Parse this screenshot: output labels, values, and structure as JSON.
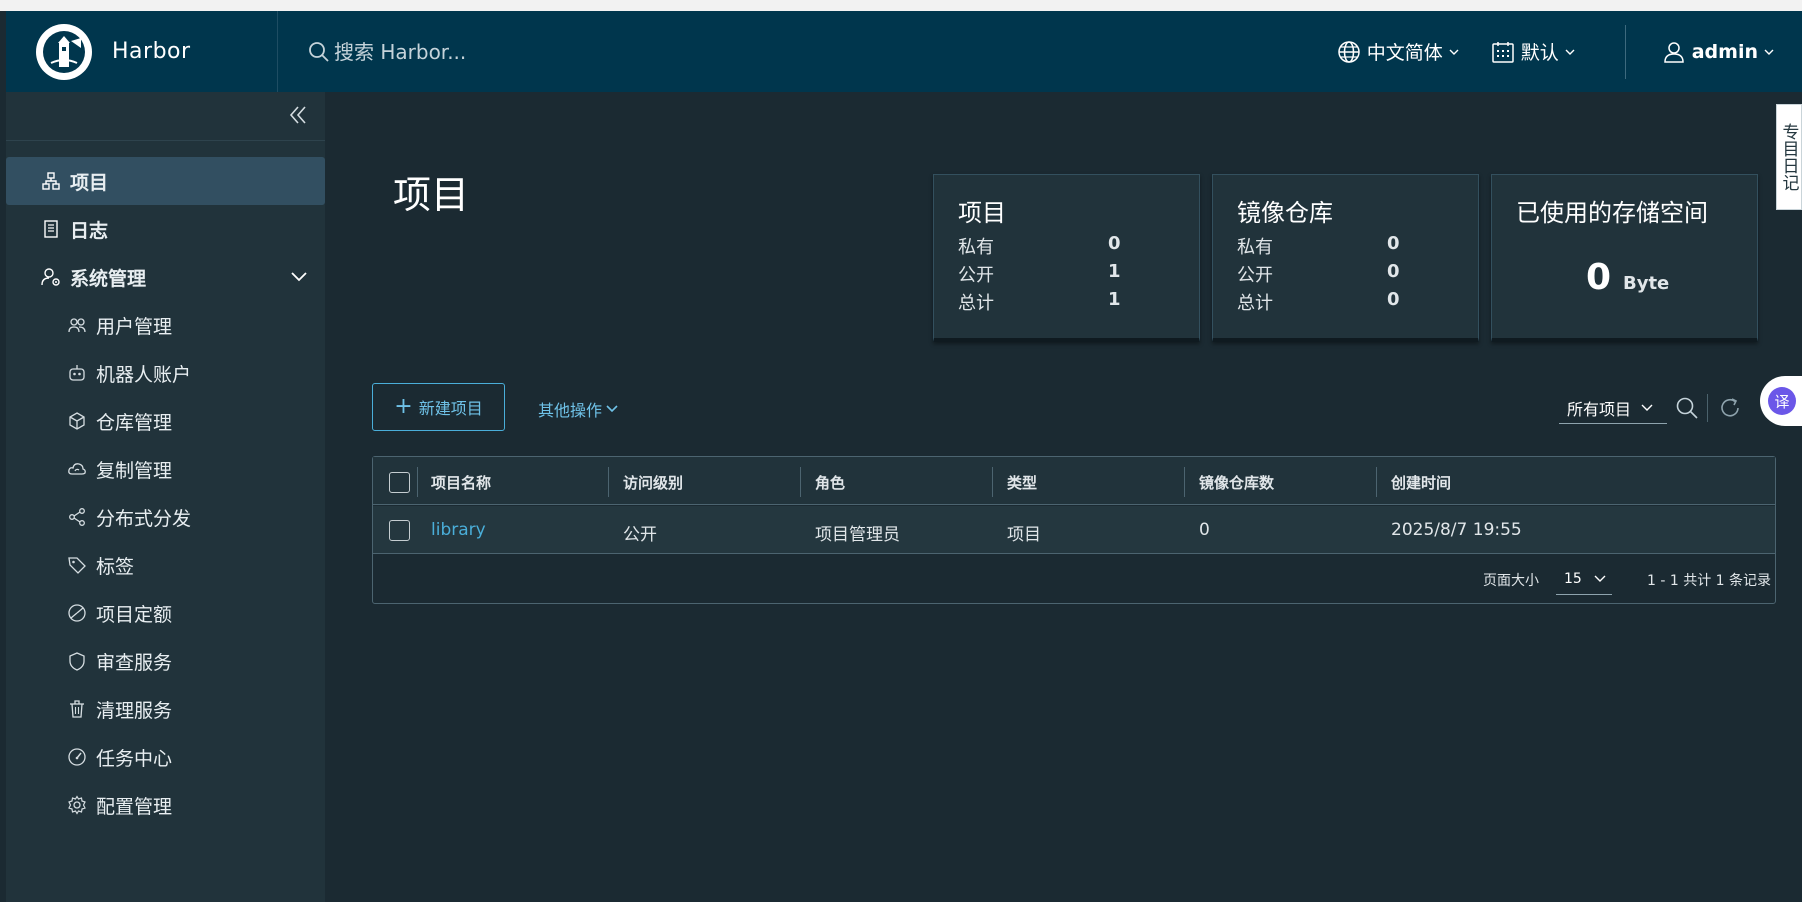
{
  "header": {
    "brand": "Harbor",
    "search_placeholder": "搜索 Harbor...",
    "language": "中文简体",
    "datetime_format": "默认",
    "user": "admin"
  },
  "sidebar": {
    "items": [
      {
        "label": "项目",
        "icon": "project-icon",
        "level": "top",
        "active": true
      },
      {
        "label": "日志",
        "icon": "log-icon",
        "level": "top"
      },
      {
        "label": "系统管理",
        "icon": "admin-settings-icon",
        "level": "top",
        "expanded": true
      },
      {
        "label": "用户管理",
        "icon": "users-icon",
        "level": "sub"
      },
      {
        "label": "机器人账户",
        "icon": "robot-icon",
        "level": "sub"
      },
      {
        "label": "仓库管理",
        "icon": "registry-box-icon",
        "level": "sub"
      },
      {
        "label": "复制管理",
        "icon": "cloud-sync-icon",
        "level": "sub"
      },
      {
        "label": "分布式分发",
        "icon": "share-icon",
        "level": "sub"
      },
      {
        "label": "标签",
        "icon": "tag-icon",
        "level": "sub"
      },
      {
        "label": "项目定额",
        "icon": "quota-pie-icon",
        "level": "sub"
      },
      {
        "label": "审查服务",
        "icon": "shield-icon",
        "level": "sub"
      },
      {
        "label": "清理服务",
        "icon": "trash-icon",
        "level": "sub"
      },
      {
        "label": "任务中心",
        "icon": "dashboard-gauge-icon",
        "level": "sub"
      },
      {
        "label": "配置管理",
        "icon": "gear-icon",
        "level": "sub"
      }
    ]
  },
  "main": {
    "title": "项目",
    "cards": {
      "projects": {
        "title": "项目",
        "rows": [
          {
            "label": "私有",
            "value": "0"
          },
          {
            "label": "公开",
            "value": "1"
          },
          {
            "label": "总计",
            "value": "1"
          }
        ]
      },
      "repos": {
        "title": "镜像仓库",
        "rows": [
          {
            "label": "私有",
            "value": "0"
          },
          {
            "label": "公开",
            "value": "0"
          },
          {
            "label": "总计",
            "value": "0"
          }
        ]
      },
      "storage": {
        "title": "已使用的存储空间",
        "value": "0",
        "unit": "Byte"
      }
    },
    "actions": {
      "new_project": "新建项目",
      "more_actions": "其他操作",
      "filter": "所有项目"
    },
    "table": {
      "columns": [
        "项目名称",
        "访问级别",
        "角色",
        "类型",
        "镜像仓库数",
        "创建时间"
      ],
      "rows": [
        {
          "name": "library",
          "access": "公开",
          "role": "项目管理员",
          "type": "项目",
          "repo_count": "0",
          "created": "2025/8/7 19:55"
        }
      ],
      "footer": {
        "page_size_label": "页面大小",
        "page_size": "15",
        "count": "1 - 1 共计 1 条记录"
      }
    }
  },
  "overlay": {
    "side_tab": "专目日记",
    "translate": "译"
  },
  "colors": {
    "header_bg": "#00364d",
    "sidebar_bg": "#21333b",
    "main_bg": "#1b2a32",
    "accent": "#4aaed9"
  }
}
